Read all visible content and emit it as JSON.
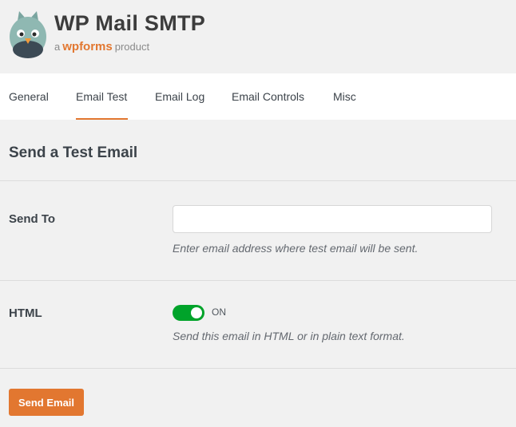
{
  "brand": {
    "title": "WP Mail SMTP",
    "sub_prefix": "a",
    "sub_brand": "wpforms",
    "sub_suffix": "product"
  },
  "tabs": [
    {
      "label": "General",
      "active": false
    },
    {
      "label": "Email Test",
      "active": true
    },
    {
      "label": "Email Log",
      "active": false
    },
    {
      "label": "Email Controls",
      "active": false
    },
    {
      "label": "Misc",
      "active": false
    }
  ],
  "section": {
    "title": "Send a Test Email"
  },
  "send_to": {
    "label": "Send To",
    "value": "",
    "placeholder": "",
    "description": "Enter email address where test email will be sent."
  },
  "html": {
    "label": "HTML",
    "enabled": true,
    "toggle_text": "ON",
    "description": "Send this email in HTML or in plain text format."
  },
  "send_button": {
    "label": "Send Email"
  },
  "colors": {
    "accent": "#e27730",
    "toggle_on": "#00a32a",
    "background": "#f1f1f1"
  }
}
